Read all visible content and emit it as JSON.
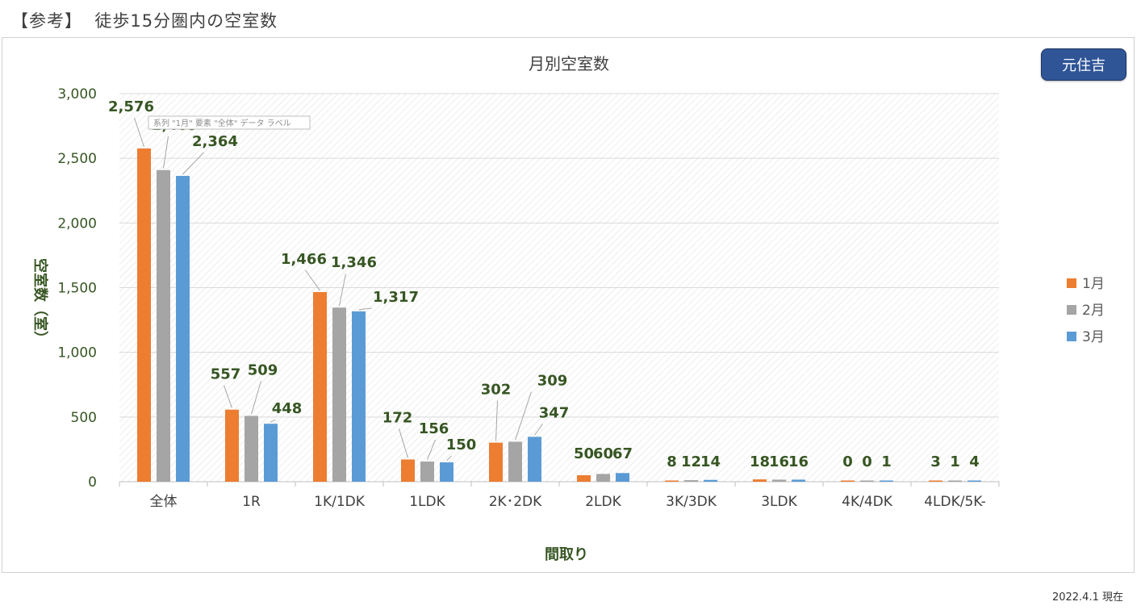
{
  "header": {
    "title": "【参考】  徒歩15分圏内の空室数"
  },
  "region_button": {
    "label": "元住吉"
  },
  "footer": {
    "date_note": "2022.4.1 現在"
  },
  "tooltip": {
    "text": "系列 \"1月\" 要素 \"全体\" データ ラベル"
  },
  "chart_data": {
    "type": "bar",
    "title": "月別空室数",
    "xlabel": "間取り",
    "ylabel": "空室数（室）",
    "ylim": [
      0,
      3000
    ],
    "yticks": [
      "0",
      "500",
      "1,000",
      "1,500",
      "2,000",
      "2,500",
      "3,000"
    ],
    "ytick_values": [
      0,
      500,
      1000,
      1500,
      2000,
      2500,
      3000
    ],
    "categories": [
      "全体",
      "1R",
      "1K/1DK",
      "1LDK",
      "2K･2DK",
      "2LDK",
      "3K/3DK",
      "3LDK",
      "4K/4DK",
      "4LDK/5K-"
    ],
    "series": [
      {
        "name": "1月",
        "color": "#ed7d31",
        "values": [
          2576,
          557,
          1466,
          172,
          302,
          50,
          8,
          18,
          0,
          3
        ],
        "labels": [
          "2,576",
          "557",
          "1,466",
          "172",
          "302",
          "50",
          "8",
          "18",
          "0",
          "3"
        ]
      },
      {
        "name": "2月",
        "color": "#a5a5a5",
        "values": [
          2409,
          509,
          1346,
          156,
          309,
          60,
          12,
          16,
          0,
          1
        ],
        "labels": [
          "2,409",
          "509",
          "1,346",
          "156",
          "309",
          "60",
          "12",
          "16",
          "0",
          "1"
        ]
      },
      {
        "name": "3月",
        "color": "#5b9bd5",
        "values": [
          2364,
          448,
          1317,
          150,
          347,
          67,
          14,
          16,
          1,
          4
        ],
        "labels": [
          "2,364",
          "448",
          "1,317",
          "150",
          "347",
          "67",
          "14",
          "16",
          "1",
          "4"
        ]
      }
    ],
    "grid": true,
    "legend_position": "right"
  }
}
